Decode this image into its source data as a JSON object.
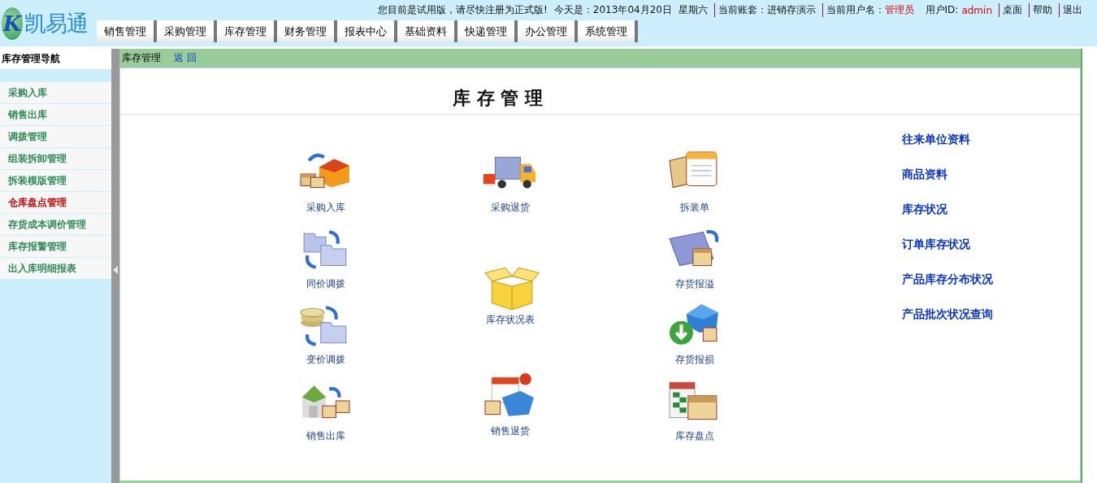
{
  "header": {
    "logo_mark": "K",
    "logo": "凯易通",
    "notice": "您目前是试用版，请尽快注册为正式版!",
    "today": "今天是：2013年04月20日  星期六",
    "account": "当前账套：进销存演示",
    "user_label": "当前用户名：",
    "user_name": "管理员",
    "user_id_label": "用户ID:",
    "user_id": "admin",
    "links": [
      "桌面",
      "帮助",
      "退出"
    ]
  },
  "tabs": [
    {
      "label": "销售管理",
      "selected": false
    },
    {
      "label": "采购管理",
      "selected": false
    },
    {
      "label": "库存管理",
      "selected": false
    },
    {
      "label": "财务管理",
      "selected": false
    },
    {
      "label": "报表中心",
      "selected": false
    },
    {
      "label": "基础资料",
      "selected": false
    },
    {
      "label": "快递管理",
      "selected": false
    },
    {
      "label": "办公管理",
      "selected": false
    },
    {
      "label": "系统管理",
      "selected": false
    }
  ],
  "sidebar": {
    "title": "库存管理导航",
    "items": [
      {
        "label": "采购入库",
        "selected": false
      },
      {
        "label": "销售出库",
        "selected": false
      },
      {
        "label": "调拨管理",
        "selected": false
      },
      {
        "label": "组装拆卸管理",
        "selected": false
      },
      {
        "label": "拆装模版管理",
        "selected": false
      },
      {
        "label": "仓库盘点管理",
        "selected": true
      },
      {
        "label": "存货成本调价管理",
        "selected": false
      },
      {
        "label": "库存报警管理",
        "selected": false
      },
      {
        "label": "出入库明细报表",
        "selected": false
      }
    ]
  },
  "breadcrumb": {
    "current": "库存管理",
    "back": "返 回"
  },
  "page_title": "库 存 管 理",
  "module_columns": [
    [
      {
        "label": "采购入库",
        "kind": "stock-in"
      },
      {
        "label": "同价调拨",
        "kind": "transfer"
      },
      {
        "label": "变价调拨",
        "kind": "reprice"
      },
      {
        "label": "销售出库",
        "kind": "stock-out"
      }
    ],
    [
      {
        "label": "采购退货",
        "kind": "truck"
      },
      {
        "label": "库存状况表",
        "kind": "open-box"
      },
      {
        "label": "销售退货",
        "kind": "return"
      }
    ],
    [
      {
        "label": "拆装单",
        "kind": "document"
      },
      {
        "label": "存货报溢",
        "kind": "overflow"
      },
      {
        "label": "存货报损",
        "kind": "loss"
      },
      {
        "label": "库存盘点",
        "kind": "count"
      }
    ]
  ],
  "quick_links": [
    "往来单位资料",
    "商品资料",
    "库存状况",
    "订单库存状况",
    "产品库存分布状况",
    "产品批次状况查询"
  ]
}
